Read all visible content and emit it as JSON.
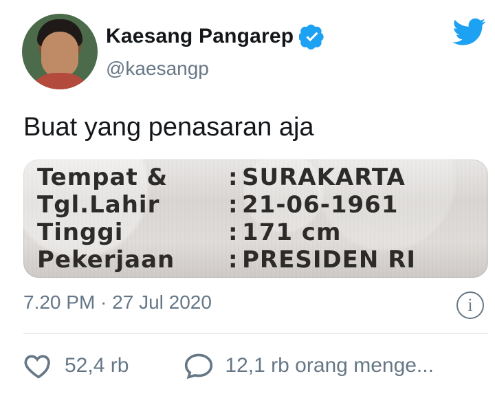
{
  "tweet": {
    "author_name": "Kaesang Pangarep",
    "author_handle": "@kaesangp",
    "text": "Buat yang penasaran aja",
    "timestamp": "7.20 PM · 27 Jul 2020",
    "likes": "52,4 rb",
    "replies": "12,1 rb orang menge...",
    "verified": true
  },
  "card": {
    "rows": [
      {
        "k": "Tempat &",
        "v": "SURAKARTA"
      },
      {
        "k": "Tgl.Lahir",
        "v": "21-06-1961"
      },
      {
        "k": "Tinggi",
        "v": "171 cm"
      },
      {
        "k": "Pekerjaan",
        "v": "PRESIDEN RI"
      }
    ]
  },
  "icons": {
    "twitter_bird": "twitter-bird-icon",
    "verified": "verified-badge-icon",
    "info": "info-icon",
    "like": "heart-icon",
    "reply": "reply-bubble-icon"
  },
  "colors": {
    "twitter_blue": "#1da1f2",
    "secondary_text": "#657786",
    "primary_text": "#14171a"
  }
}
